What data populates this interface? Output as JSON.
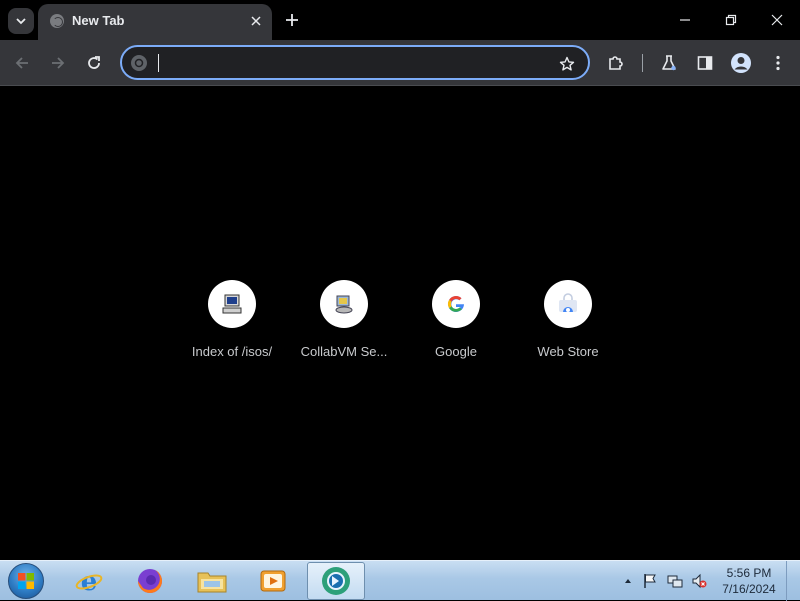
{
  "browser": {
    "tab": {
      "title": "New Tab"
    },
    "omnibox": {
      "value": "",
      "placeholder": ""
    }
  },
  "shortcuts": [
    {
      "label": "Index of /isos/",
      "icon": "computer-icon"
    },
    {
      "label": "CollabVM Se...",
      "icon": "collabvm-icon"
    },
    {
      "label": "Google",
      "icon": "google-g-icon"
    },
    {
      "label": "Web Store",
      "icon": "web-store-icon"
    }
  ],
  "taskbar": {
    "apps": [
      {
        "icon": "internet-explorer-icon"
      },
      {
        "icon": "firefox-icon"
      },
      {
        "icon": "file-explorer-icon"
      },
      {
        "icon": "media-player-icon"
      },
      {
        "icon": "chrome-icon",
        "active": true
      }
    ],
    "clock": {
      "time": "5:56 PM",
      "date": "7/16/2024"
    }
  },
  "colors": {
    "accent": "#7cacf8",
    "tab_bg": "#35363a",
    "page_bg": "#000000"
  }
}
